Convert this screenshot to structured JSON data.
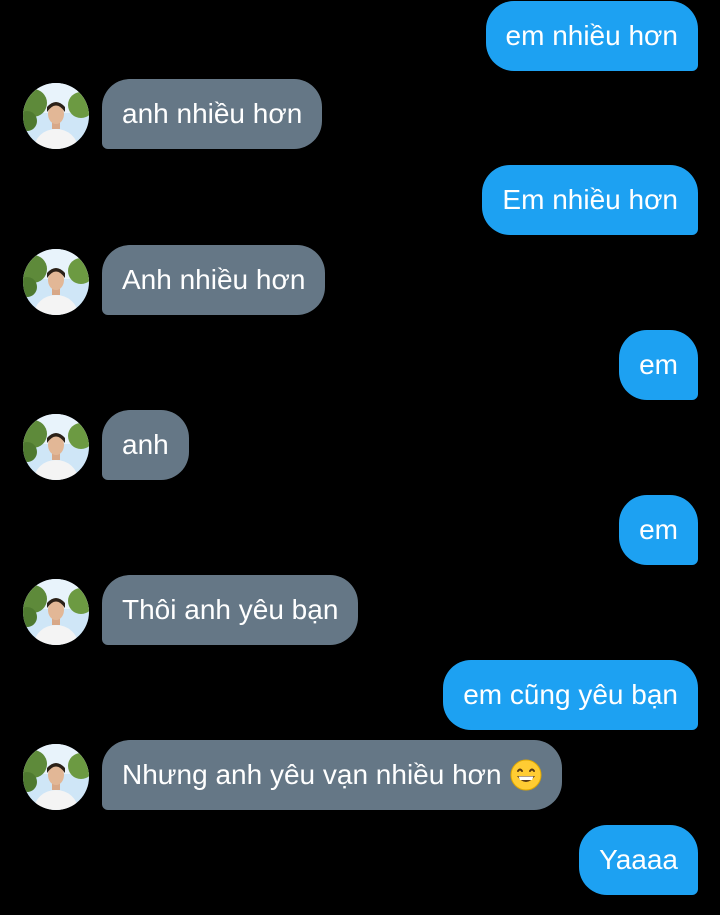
{
  "conversation": {
    "messages": [
      {
        "from": "me",
        "text": "em nhiều hơn"
      },
      {
        "from": "them",
        "text": "anh nhiều hơn"
      },
      {
        "from": "me",
        "text": "Em nhiều hơn"
      },
      {
        "from": "them",
        "text": "Anh nhiều hơn"
      },
      {
        "from": "me",
        "text": "em"
      },
      {
        "from": "them",
        "text": "anh"
      },
      {
        "from": "me",
        "text": "em"
      },
      {
        "from": "them",
        "text": "Thôi anh yêu bạn"
      },
      {
        "from": "me",
        "text": "em cũng yêu bạn"
      },
      {
        "from": "them",
        "text": "Nhưng anh yêu vạn nhiều hơn",
        "emoji": "grinning-face-icon"
      },
      {
        "from": "me",
        "text": "Yaaaa"
      }
    ]
  },
  "colors": {
    "background": "#000000",
    "sent_bubble": "#1da1f2",
    "received_bubble": "#657786",
    "text": "#ffffff"
  }
}
